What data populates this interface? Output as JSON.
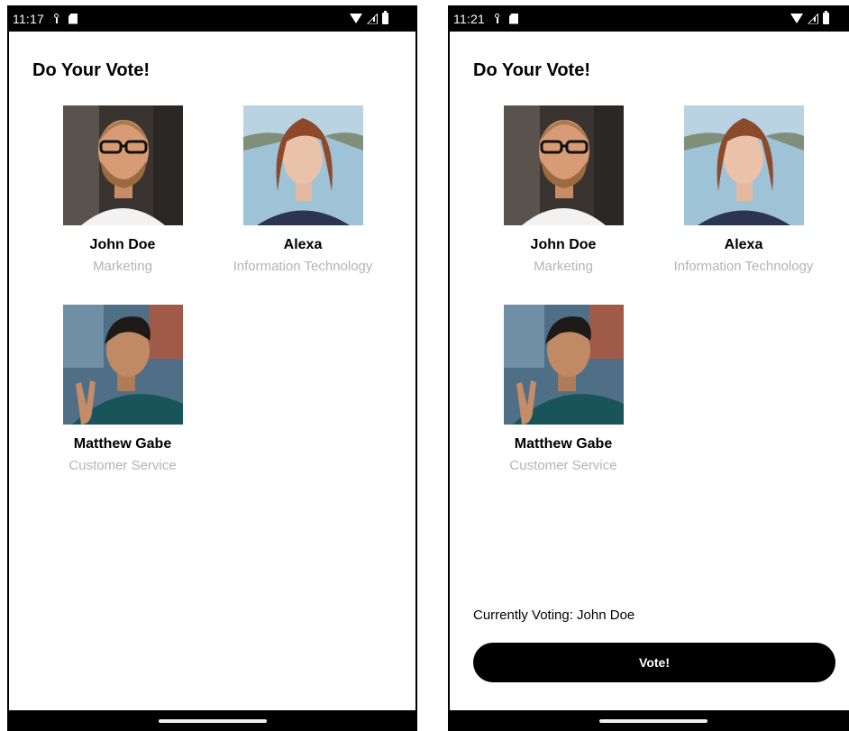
{
  "left_screen": {
    "status_bar": {
      "time": "11:17"
    },
    "title": "Do Your Vote!",
    "candidates": [
      {
        "name": "John Doe",
        "department": "Marketing"
      },
      {
        "name": "Alexa",
        "department": "Information Technology"
      },
      {
        "name": "Matthew Gabe",
        "department": "Customer Service"
      }
    ]
  },
  "right_screen": {
    "status_bar": {
      "time": "11:21"
    },
    "title": "Do Your Vote!",
    "candidates": [
      {
        "name": "John Doe",
        "department": "Marketing"
      },
      {
        "name": "Alexa",
        "department": "Information Technology"
      },
      {
        "name": "Matthew Gabe",
        "department": "Customer Service"
      }
    ],
    "current_vote_text": "Currently Voting: John Doe",
    "vote_button_label": "Vote!"
  },
  "icons": {
    "status_left": [
      "usb-debug-icon",
      "sd-card-icon"
    ],
    "status_right": [
      "wifi-icon",
      "cell-signal-icon",
      "battery-icon"
    ]
  },
  "colors": {
    "background": "#ffffff",
    "bars": "#000000",
    "primary_text": "#000000",
    "secondary_text": "#b4b4b4",
    "button_background": "#000000",
    "button_text": "#ffffff"
  }
}
